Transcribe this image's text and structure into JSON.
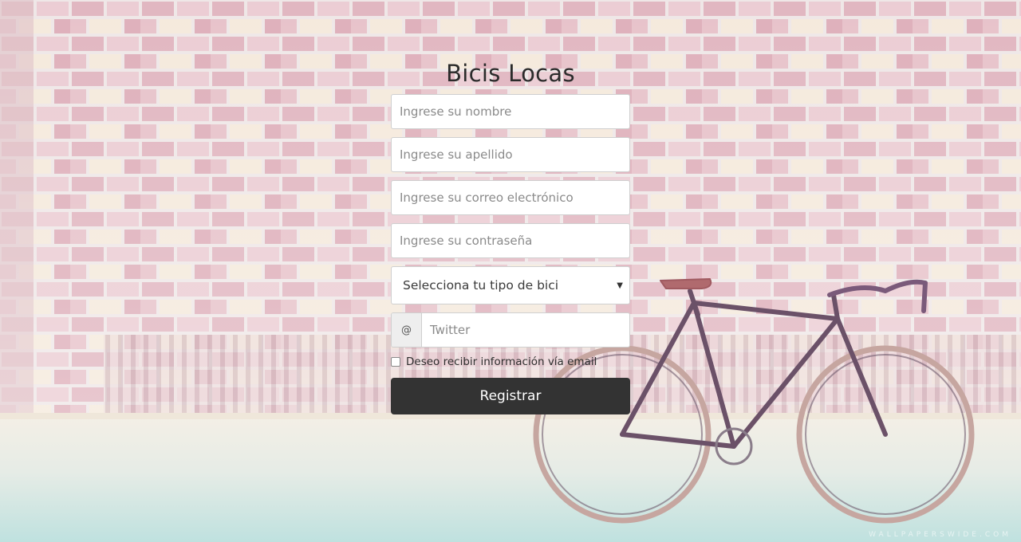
{
  "form": {
    "title": "Bicis Locas",
    "nombre_placeholder": "Ingrese su nombre",
    "apellido_placeholder": "Ingrese su apellido",
    "correo_placeholder": "Ingrese su correo electrónico",
    "contrasena_placeholder": "Ingrese su contraseña",
    "bike_select_value": "Selecciona tu tipo de bici",
    "twitter_addon": "@",
    "twitter_placeholder": "Twitter",
    "newsletter_label": "Deseo recibir información vía email",
    "newsletter_checked": false,
    "submit_label": "Registrar"
  },
  "background": {
    "watermark": "WALLPAPERSWIDE.COM"
  },
  "colors": {
    "button_bg": "#333333",
    "button_text": "#ffffff",
    "title": "#2b2b2b"
  },
  "icons": {
    "select_arrow": "caret-down-icon"
  }
}
